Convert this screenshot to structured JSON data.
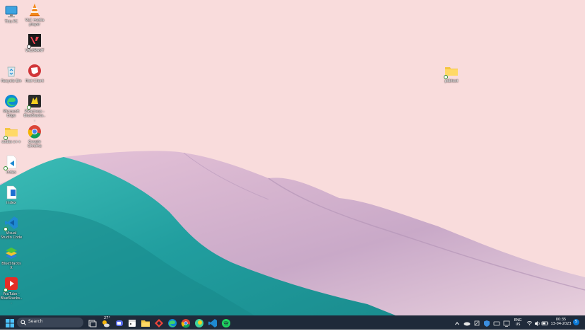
{
  "desktop": {
    "icons": [
      {
        "label": "This PC"
      },
      {
        "label": "VLC media player"
      },
      {
        "label": "VALORANT"
      },
      {
        "label": "Recycle Bin"
      },
      {
        "label": "Riot Client"
      },
      {
        "label": "Microsoft Edge"
      },
      {
        "label": "Pikachess - BlueStacks..."
      },
      {
        "label": "codes c++"
      },
      {
        "label": "Google Chrome"
      },
      {
        "label": "index"
      },
      {
        "label": "index"
      },
      {
        "label": "Visual Studio Code"
      },
      {
        "label": "BlueStacks X"
      },
      {
        "label": "YouTube - BlueStacks..."
      },
      {
        "label": "pdbtest"
      }
    ]
  },
  "taskbar": {
    "search_label": "Search",
    "weather_temp": "27°",
    "tray": {
      "lang_line1": "ENG",
      "lang_line2": "US",
      "time": "00:35",
      "date": "13-04-2023",
      "notification_count": "5"
    }
  },
  "colors": {
    "sky": "#f9dcdc",
    "dune_teal": "#2aa9a9",
    "dune_pink": "#d7b7cf",
    "taskbar": "#1f2a3a",
    "accent": "#0a78d4"
  }
}
